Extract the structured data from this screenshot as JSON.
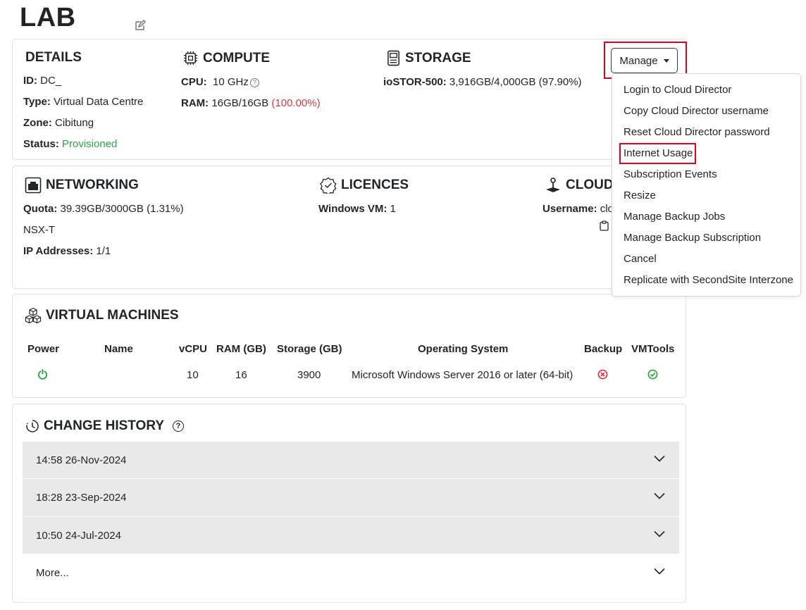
{
  "page": {
    "title": "LAB"
  },
  "details": {
    "heading": "DETAILS",
    "id_label": "ID:",
    "id_value": "DC_",
    "type_label": "Type:",
    "type_value": "Virtual Data Centre",
    "zone_label": "Zone:",
    "zone_value": "Cibitung",
    "status_label": "Status:",
    "status_value": "Provisioned"
  },
  "compute": {
    "heading": "COMPUTE",
    "cpu_label": "CPU:",
    "cpu_value": "10 GHz",
    "ram_label": "RAM:",
    "ram_value": "16GB/16GB",
    "ram_pct": "(100.00%)"
  },
  "storage": {
    "heading": "STORAGE",
    "tier_label": "ioSTOR-500:",
    "tier_value": "3,916GB/4,000GB (97.90%)"
  },
  "manage": {
    "button_label": "Manage",
    "menu": [
      "Login to Cloud Director",
      "Copy Cloud Director username",
      "Reset Cloud Director password",
      "Internet Usage",
      "Subscription Events",
      "Resize",
      "Manage Backup Jobs",
      "Manage Backup Subscription",
      "Cancel",
      "Replicate with SecondSite Interzone"
    ],
    "highlighted_item": "Internet Usage"
  },
  "networking": {
    "heading": "NETWORKING",
    "quota_label": "Quota:",
    "quota_value": "39.39GB/3000GB (1.31%)",
    "nsx": "NSX-T",
    "ip_label": "IP Addresses:",
    "ip_value": "1/1"
  },
  "licences": {
    "heading": "LICENCES",
    "win_label": "Windows VM:",
    "win_value": "1"
  },
  "cloud": {
    "heading": "CLOUD",
    "username_label": "Username:",
    "username_value": "clo"
  },
  "vms": {
    "heading": "VIRTUAL MACHINES",
    "columns": [
      "Power",
      "Name",
      "vCPU",
      "RAM (GB)",
      "Storage (GB)",
      "Operating System",
      "Backup",
      "VMTools"
    ],
    "rows": [
      {
        "name": "",
        "vcpu": "10",
        "ram": "16",
        "storage": "3900",
        "os": "Microsoft Windows Server 2016 or later (64-bit)"
      }
    ]
  },
  "history": {
    "heading": "CHANGE HISTORY",
    "entries": [
      "14:58 26-Nov-2024",
      "18:28 23-Sep-2024",
      "10:50 24-Jul-2024"
    ],
    "more": "More..."
  },
  "colors": {
    "success": "#28a745",
    "danger": "#dc3545",
    "highlight": "#e3001b"
  }
}
